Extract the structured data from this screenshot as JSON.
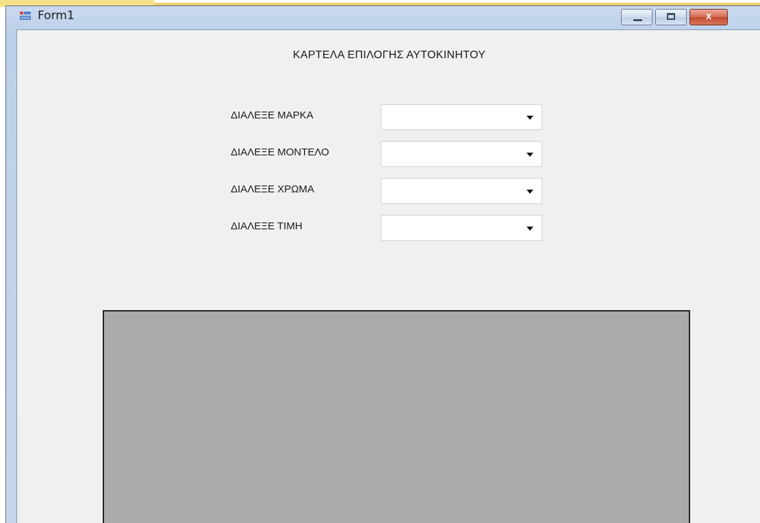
{
  "window": {
    "title": "Form1",
    "minimize_glyph": "",
    "maximize_glyph": "",
    "close_glyph": "x"
  },
  "form": {
    "heading": "ΚΑΡΤΕΛΑ ΕΠΙΛΟΓΗΣ ΑΥΤΟΚΙΝΗΤΟΥ",
    "fields": [
      {
        "label": "ΔΙΑΛΕΞΕ ΜΑΡΚΑ",
        "value": ""
      },
      {
        "label": "ΔΙΑΛΕΞΕ ΜΟΝΤΕΛΟ",
        "value": ""
      },
      {
        "label": "ΔΙΑΛΕΞΕ ΧΡΩΜΑ",
        "value": ""
      },
      {
        "label": "ΔΙΑΛΕΞΕ ΤΙΜΗ",
        "value": ""
      }
    ]
  },
  "colors": {
    "client_background": "#f0f0f0",
    "picture_box": "#ababab",
    "close_button": "#c24a30"
  },
  "icons": {
    "app": "form-app-icon",
    "minimize": "minimize-icon",
    "maximize": "maximize-icon",
    "close": "close-icon",
    "combo_arrow": "chevron-down-icon"
  }
}
